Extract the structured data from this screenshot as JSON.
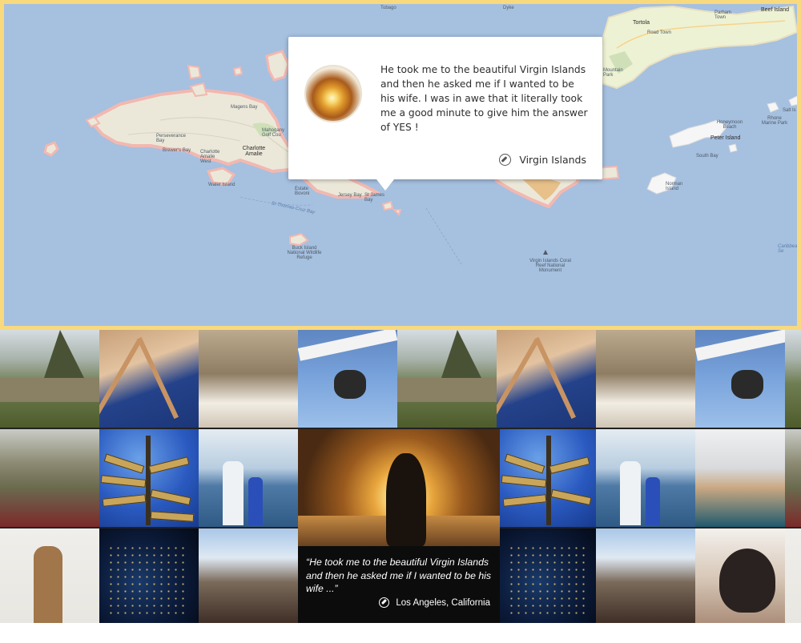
{
  "map": {
    "labels": {
      "tobago": "Tobago",
      "dyke": "Dyke",
      "beef_island_top": "Beef Island",
      "parham_town": "Parham Town",
      "tortola": "Tortola",
      "road_town": "Road Town",
      "mountain_park": "Mountain Park",
      "magens_bay": "Magens Bay",
      "mahogany_golf": "Mahogany Golf Cou",
      "charlotte_amalie": "Charlotte Amalie",
      "charlotte_amalie_west": "Charlotte Amalie West",
      "brewers_bay": "Brewer's Bay",
      "perseverance_bay": "Perseverance Bay",
      "water_island": "Water Island",
      "estate_bovoni": "Estate Bovoni",
      "st_thomas_cruz_bay": "St Thomas-Cruz Bay",
      "jersey_bay": "Jersey Bay",
      "st_james_bay": "St James Bay",
      "buck_island": "Buck Island National Wildlife Refuge",
      "vi_coral_reef": "Virgin Islands Coral Reef National Monument",
      "honeymoon_beach": "Honeymoon Beach",
      "peter_island": "Peter Island",
      "south_bay": "South Bay",
      "rhone_marine_park": "Rhone Marine Park",
      "salt_island": "Salt Is",
      "norman_island": "Norman Island",
      "caribbean_sea": "Caribbean Se"
    },
    "popup": {
      "text": "He took me to the beautiful Virgin Islands and then he asked me if I wanted to be his wife. I was in awe that it literally took me a good minute to give him the answer of YES !",
      "location": "Virgin Islands",
      "location_icon": "compass-icon"
    }
  },
  "grid": {
    "feature": {
      "quote": "“He took me to the beautiful Virgin Islands and then he asked me if I wanted to be his wife ...”",
      "location": "Los Angeles, California",
      "location_icon": "compass-icon"
    },
    "sign": [
      "TOKYO",
      "PARIS",
      "ROME",
      "WASHINGTON",
      "TORONTO",
      "VIENNA",
      "FRANKFURT"
    ]
  },
  "colors": {
    "map_border": "#f8d97e",
    "sea": "#a6c0e0",
    "land": "#ece8d9",
    "land_border": "#f2b8b0",
    "caption_bg": "#0c0c0c"
  }
}
